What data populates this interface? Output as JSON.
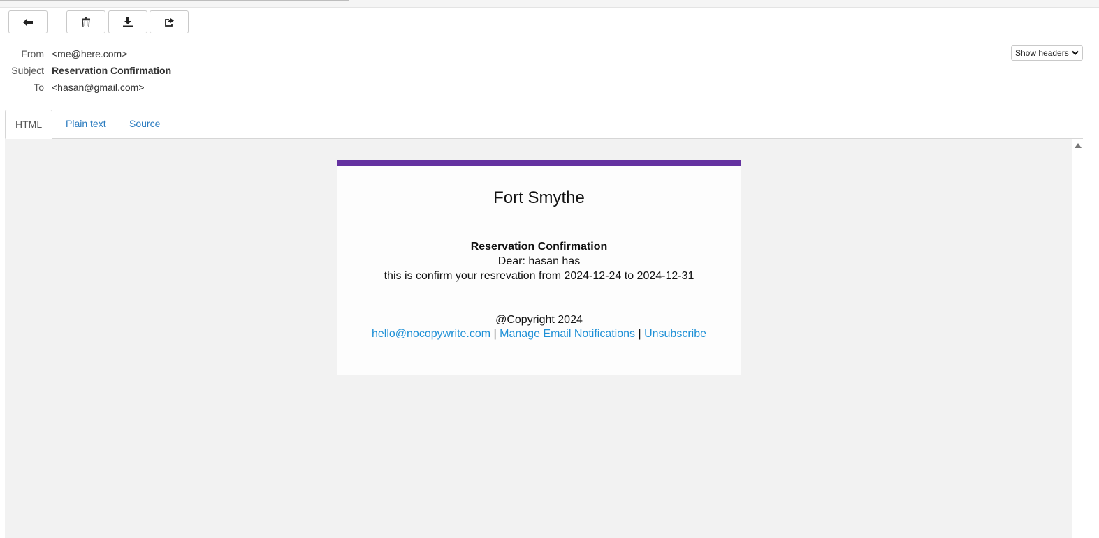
{
  "toolbar": {
    "back_icon": "arrow-left-icon",
    "delete_icon": "trash-icon",
    "download_icon": "download-icon",
    "forward_icon": "share-icon"
  },
  "headers": {
    "from_label": "From",
    "from_value": "<me@here.com>",
    "subject_label": "Subject",
    "subject_value": "Reservation Confirmation",
    "to_label": "To",
    "to_value": "<hasan@gmail.com>",
    "show_headers_label": "Show headers"
  },
  "tabs": [
    {
      "label": "HTML",
      "active": true
    },
    {
      "label": "Plain text",
      "active": false
    },
    {
      "label": "Source",
      "active": false
    }
  ],
  "email": {
    "accent_color": "#6432a0",
    "brand": "Fort Smythe",
    "heading": "Reservation Confirmation",
    "greeting": "Dear: hasan has",
    "body": "this is confirm your resrevation from 2024-12-24 to 2024-12-31",
    "copyright": "@Copyright 2024",
    "footer_links": {
      "email": "hello@nocopywrite.com",
      "separator": "|",
      "manage": "Manage Email Notifications",
      "unsubscribe": "Unsubscribe"
    }
  }
}
